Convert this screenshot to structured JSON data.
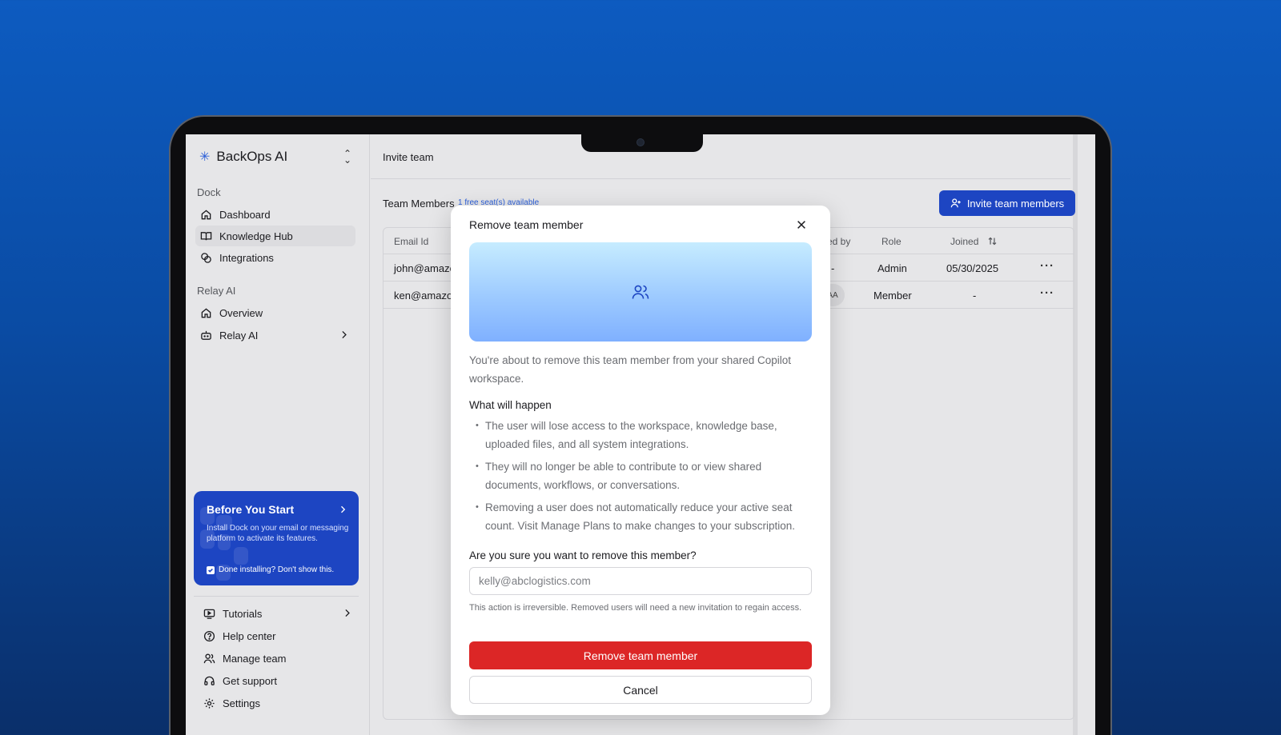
{
  "sidebar": {
    "brand": "BackOps AI",
    "sections": [
      {
        "label": "Dock"
      },
      {
        "label": "Relay AI"
      }
    ],
    "dock_items": [
      {
        "label": "Dashboard",
        "icon": "home-icon"
      },
      {
        "label": "Knowledge Hub",
        "icon": "book-icon",
        "active": true
      },
      {
        "label": "Integrations",
        "icon": "link-icon"
      }
    ],
    "relay_items": [
      {
        "label": "Overview",
        "icon": "home-icon"
      },
      {
        "label": "Relay AI",
        "icon": "bot-icon"
      }
    ],
    "promo": {
      "title": "Before You Start",
      "text": "Install Dock on your email or messaging platform to activate its features.",
      "checkbox_label": "Done installing? Don't show this."
    },
    "footer_items": [
      {
        "label": "Tutorials",
        "icon": "video-icon"
      },
      {
        "label": "Help center",
        "icon": "help-icon"
      },
      {
        "label": "Manage team",
        "icon": "users-icon"
      },
      {
        "label": "Get support",
        "icon": "headset-icon"
      },
      {
        "label": "Settings",
        "icon": "gear-icon"
      }
    ]
  },
  "main": {
    "topbar_title": "Invite team",
    "team_members_title": "Team Members",
    "seats_note": "1 free seat(s) available",
    "invite_button": "Invite team members",
    "table": {
      "headers": {
        "email": "Email Id",
        "invited_by": "ited by",
        "role": "Role",
        "joined": "Joined"
      },
      "rows": [
        {
          "email": "john@amazon",
          "invited_by": "-",
          "role": "Admin",
          "joined": "05/30/2025"
        },
        {
          "email": "ken@amazon",
          "invited_by": "AA",
          "role": "Member",
          "joined": "-"
        }
      ]
    }
  },
  "modal": {
    "title": "Remove team member",
    "description": "You're about to remove this team member from your shared Copilot workspace.",
    "what_will_happen": "What will happen",
    "bullets": [
      "The user will lose access to the workspace, knowledge base, uploaded files, and all system integrations.",
      " They will no longer be able to contribute to or view shared documents, workflows, or conversations.",
      "Removing a user does not automatically reduce your active seat count. Visit Manage Plans to make changes to your subscription."
    ],
    "question": "Are you sure you want to remove this member?",
    "input_placeholder": "kelly@abclogistics.com",
    "note": "This action is irreversible. Removed users will need a new invitation to regain access.",
    "remove_button": "Remove team member",
    "cancel_button": "Cancel"
  },
  "colors": {
    "accent": "#1d45c2",
    "danger": "#dc2626",
    "background": "#0d5bc0"
  }
}
